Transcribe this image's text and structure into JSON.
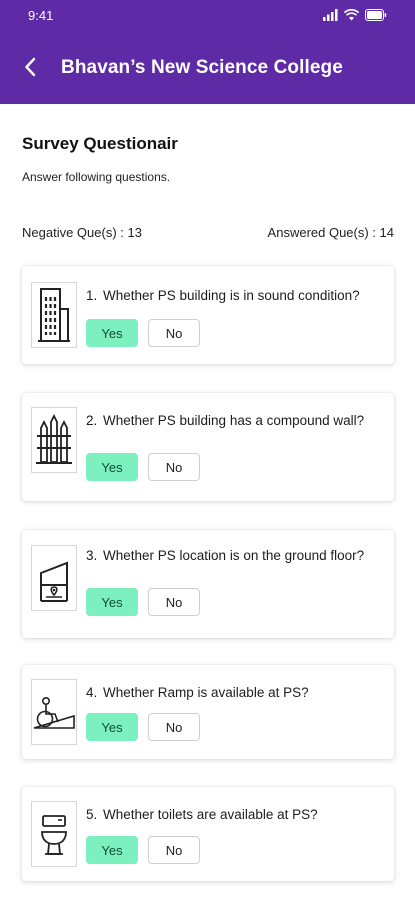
{
  "status_bar": {
    "time": "9:41",
    "icons": [
      "signal-icon",
      "wifi-icon",
      "battery-icon"
    ]
  },
  "app_bar": {
    "title": "Bhavan’s New Science College",
    "back_icon": "chevron-left-icon"
  },
  "survey": {
    "title": "Survey Questionair",
    "subtitle": "Answer following questions.",
    "negative_label": "Negative Que(s) : 13",
    "answered_label": "Answered Que(s) : 14"
  },
  "questions": [
    {
      "number": "1.",
      "text": "Whether PS building is in sound condition?",
      "icon": "building-icon",
      "yes": "Yes",
      "no": "No",
      "selected": "Yes"
    },
    {
      "number": "2.",
      "text": "Whether PS building has a compound wall?",
      "icon": "fence-icon",
      "yes": "Yes",
      "no": "No",
      "selected": "Yes"
    },
    {
      "number": "3.",
      "text": "Whether PS location is on the ground floor?",
      "icon": "ground-floor-icon",
      "yes": "Yes",
      "no": "No",
      "selected": "Yes"
    },
    {
      "number": "4.",
      "text": "Whether Ramp is available at PS?",
      "icon": "wheelchair-ramp-icon",
      "yes": "Yes",
      "no": "No",
      "selected": "Yes"
    },
    {
      "number": "5.",
      "text": "Whether toilets are available at PS?",
      "icon": "toilet-icon",
      "yes": "Yes",
      "no": "No",
      "selected": "Yes"
    }
  ],
  "colors": {
    "header": "#5e2aa6",
    "yes_selected": "#7cf0bf",
    "no_border": "#cfcfcf"
  }
}
